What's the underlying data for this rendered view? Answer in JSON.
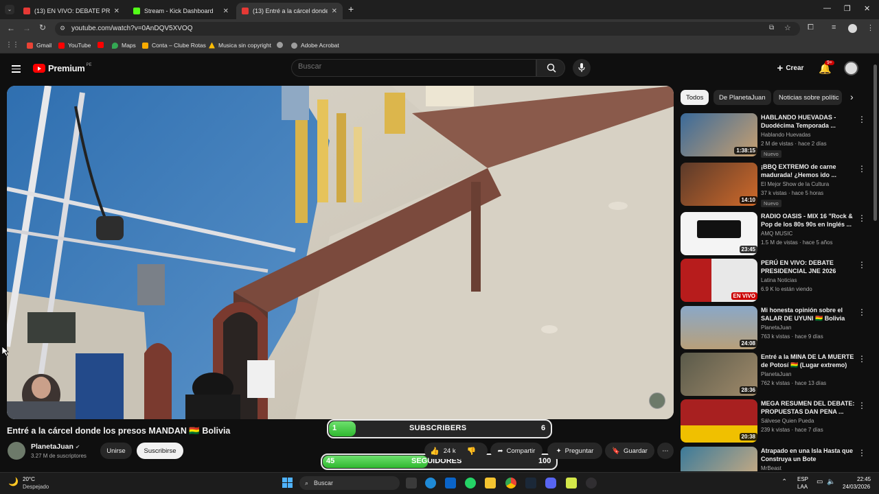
{
  "browser": {
    "tabs": [
      {
        "title": "(13) EN VIVO: DEBATE PRESIDE",
        "fav_color": "#e53935",
        "active": false
      },
      {
        "title": "Stream - Kick Dashboard",
        "fav_color": "#53fc18",
        "active": false
      },
      {
        "title": "(13) Entré a la cárcel donde",
        "fav_color": "#e53935",
        "active": true
      }
    ],
    "new_tab": "+",
    "url": "youtube.com/watch?v=0AnDQV5XVOQ",
    "bookmarks": [
      {
        "label": "Gmail",
        "color": "#ea4335"
      },
      {
        "label": "YouTube",
        "color": "#ff0000"
      },
      {
        "label": "",
        "color": "#ff0000"
      },
      {
        "label": "Maps",
        "color": "#34a853"
      },
      {
        "label": "Conta – Clube Rotas",
        "color": "#f9ab00"
      },
      {
        "label": "Musica sin copyright",
        "color": "#fbbc04"
      },
      {
        "label": "",
        "color": "#9e9e9e"
      },
      {
        "label": "Adobe Acrobat",
        "color": "#9e9e9e"
      }
    ]
  },
  "youtube": {
    "logo_text": "Premium",
    "logo_sup": "PE",
    "search_placeholder": "Buscar",
    "create_label": "Crear",
    "notif_count": "9+"
  },
  "video": {
    "title": "Entré a la cárcel donde los presos MANDAN 🇧🇴 Bolivia",
    "channel": "PlanetaJuan",
    "subscribers": "3.27 M de suscriptores",
    "join_label": "Unirse",
    "subscribe_label": "Suscribirse",
    "likes": "24 k",
    "share_label": "Compartir",
    "ask_label": "Preguntar",
    "save_label": "Guardar"
  },
  "overlays": {
    "subscribers": {
      "current": "1",
      "label": "SUBSCRIBERS",
      "goal": "6",
      "fraction": 0.12
    },
    "followers": {
      "current": "45",
      "label": "SEGUIDORES",
      "goal": "100",
      "fraction": 0.45
    }
  },
  "sidebar": {
    "chips": [
      "Todos",
      "De PlanetaJuan",
      "Noticias sobre polític"
    ],
    "recommendations": [
      {
        "title": "HABLANDO HUEVADAS - Duodécima Temporada ...",
        "channel": "Hablando Huevadas",
        "meta": "2 M de vistas · hace 2 días",
        "duration": "1:38:15",
        "badge": "Nuevo",
        "thumb": "#3a6a9a"
      },
      {
        "title": "¡BBQ EXTREMO de carne madurada! ¿Hemos ido ...",
        "channel": "El Mejor Show de la Cultura",
        "meta": "37 k vistas · hace 5 horas",
        "duration": "14:10",
        "badge": "Nuevo",
        "thumb": "#5a3a2a"
      },
      {
        "title": "RADIO OASIS - MIX 16 \"Rock & Pop de los 80s 90s en Inglés ...",
        "channel": "AMQ MUSIC",
        "meta": "1.5 M de vistas · hace 5 años",
        "duration": "23:45",
        "badge": "",
        "thumb": "#f4f4f4"
      },
      {
        "title": "PERÚ EN VIVO: DEBATE PRESIDENCIAL JNE 2026",
        "channel": "Latina Noticias",
        "meta": "6.9 K lo están viendo",
        "duration": "EN VIVO",
        "badge": "",
        "thumb": "#b71c1c"
      },
      {
        "title": "Mi honesta opinión sobre el SALAR DE UYUNI 🇧🇴 Bolivia",
        "channel": "PlanetaJuan",
        "meta": "763 k vistas · hace 9 días",
        "duration": "24:08",
        "badge": "",
        "thumb": "#8a7a5a"
      },
      {
        "title": "Entré a la MINA DE LA MUERTE de Potosí 🇧🇴 (Lugar extremo)",
        "channel": "PlanetaJuan",
        "meta": "762 k vistas · hace 13 días",
        "duration": "28:36",
        "badge": "",
        "thumb": "#5a5a4a"
      },
      {
        "title": "MEGA RESUMEN DEL DEBATE: PROPUESTAS DAN PENA ...",
        "channel": "Sálvese Quien Pueda",
        "meta": "239 k vistas · hace 7 días",
        "duration": "20:38",
        "badge": "",
        "thumb": "#a82020"
      },
      {
        "title": "Atrapado en una Isla Hasta que Construya un Bote",
        "channel": "MrBeast",
        "meta": "",
        "duration": "",
        "badge": "",
        "thumb": "#3a7a9a"
      }
    ]
  },
  "taskbar": {
    "weather_temp": "20°C",
    "weather_desc": "Despejado",
    "search_label": "Buscar",
    "lang_top": "ESP",
    "lang_bottom": "LAA",
    "time": "22:45",
    "date": "24/03/2026"
  }
}
